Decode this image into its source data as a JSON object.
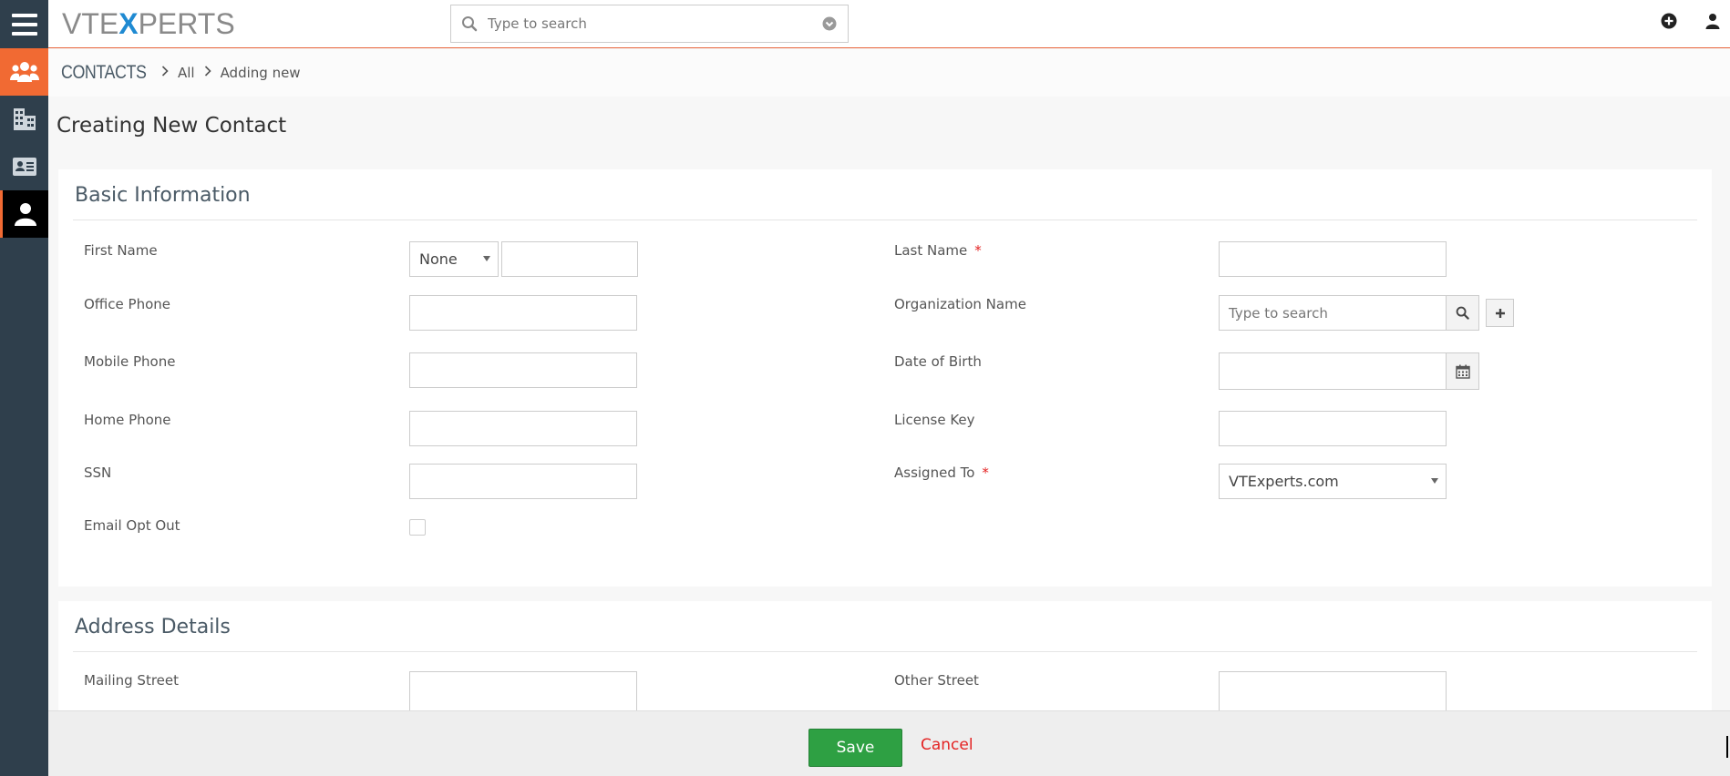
{
  "topbar": {
    "logo_prefix": "VTE",
    "logo_x": "X",
    "logo_suffix": "PERTS",
    "search_placeholder": "Type to search",
    "icons": [
      "menu-icon",
      "search-icon",
      "chevron-down-circle-icon",
      "plus-circle-icon",
      "user-icon"
    ]
  },
  "sidebar": {
    "items": [
      {
        "icon": "users-group-icon",
        "state": "module-home"
      },
      {
        "icon": "building-icon",
        "state": "normal"
      },
      {
        "icon": "id-card-icon",
        "state": "normal"
      },
      {
        "icon": "user-icon",
        "state": "active"
      }
    ]
  },
  "breadcrumb": {
    "module": "CONTACTS",
    "items": [
      "All",
      "Adding new"
    ]
  },
  "page": {
    "title": "Creating New Contact"
  },
  "basic": {
    "title": "Basic Information",
    "first_name_label": "First Name",
    "salutation_value": "None",
    "last_name_label": "Last Name",
    "office_phone_label": "Office Phone",
    "organization_label": "Organization Name",
    "organization_placeholder": "Type to search",
    "mobile_phone_label": "Mobile Phone",
    "dob_label": "Date of Birth",
    "home_phone_label": "Home Phone",
    "license_key_label": "License Key",
    "ssn_label": "SSN",
    "assigned_to_label": "Assigned To",
    "assigned_to_value": "VTExperts.com",
    "email_opt_out_label": "Email Opt Out",
    "required_mark": "*"
  },
  "address": {
    "title": "Address Details",
    "mailing_street_label": "Mailing Street",
    "other_street_label": "Other Street"
  },
  "footer": {
    "save_label": "Save",
    "cancel_label": "Cancel"
  },
  "colors": {
    "accent": "#f16a33",
    "sidebar": "#2f3f4c",
    "save": "#2ea043",
    "cancel": "#e42323",
    "logo_blue": "#1f8ad2"
  }
}
